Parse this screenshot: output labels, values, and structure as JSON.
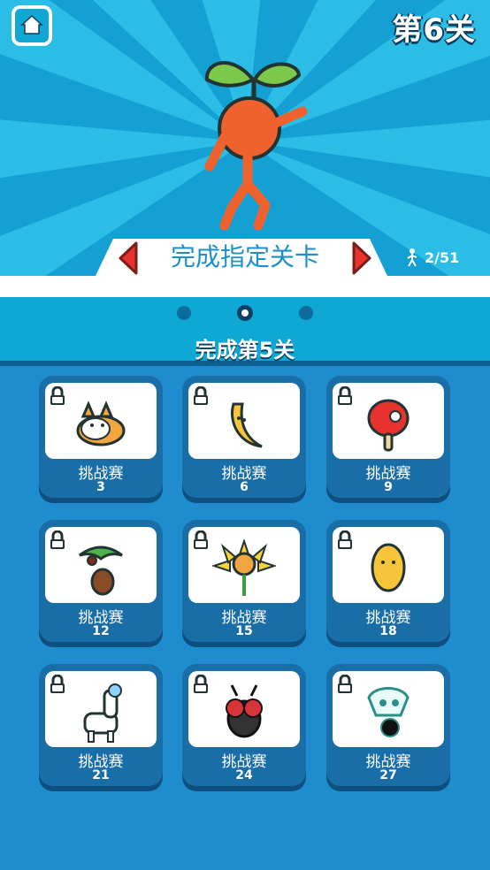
{
  "header": {
    "level_title": "第6关",
    "banner_text": "完成指定关卡",
    "progress": "2/51"
  },
  "page_dots": {
    "count": 3,
    "active_index": 1
  },
  "section_title": "完成第5关",
  "challenges": [
    {
      "label": "挑战赛",
      "level": "3",
      "character": "corgi-dog-icon",
      "locked": true
    },
    {
      "label": "挑战赛",
      "level": "6",
      "character": "banana-icon",
      "locked": true
    },
    {
      "label": "挑战赛",
      "level": "9",
      "character": "ping-pong-paddle-icon",
      "locked": true
    },
    {
      "label": "挑战赛",
      "level": "12",
      "character": "coconut-tree-icon",
      "locked": true
    },
    {
      "label": "挑战赛",
      "level": "15",
      "character": "sunflower-icon",
      "locked": true
    },
    {
      "label": "挑战赛",
      "level": "18",
      "character": "potato-icon",
      "locked": true
    },
    {
      "label": "挑战赛",
      "level": "21",
      "character": "alpaca-icon",
      "locked": true
    },
    {
      "label": "挑战赛",
      "level": "24",
      "character": "fly-icon",
      "locked": true
    },
    {
      "label": "挑战赛",
      "level": "27",
      "character": "skull-bomb-icon",
      "locked": true
    }
  ],
  "colors": {
    "sky": "#1aa9d8",
    "panel": "#1e8ccd",
    "card": "#1a6ea8",
    "banner_text": "#1e90c8",
    "accent_red": "#e8322e"
  }
}
